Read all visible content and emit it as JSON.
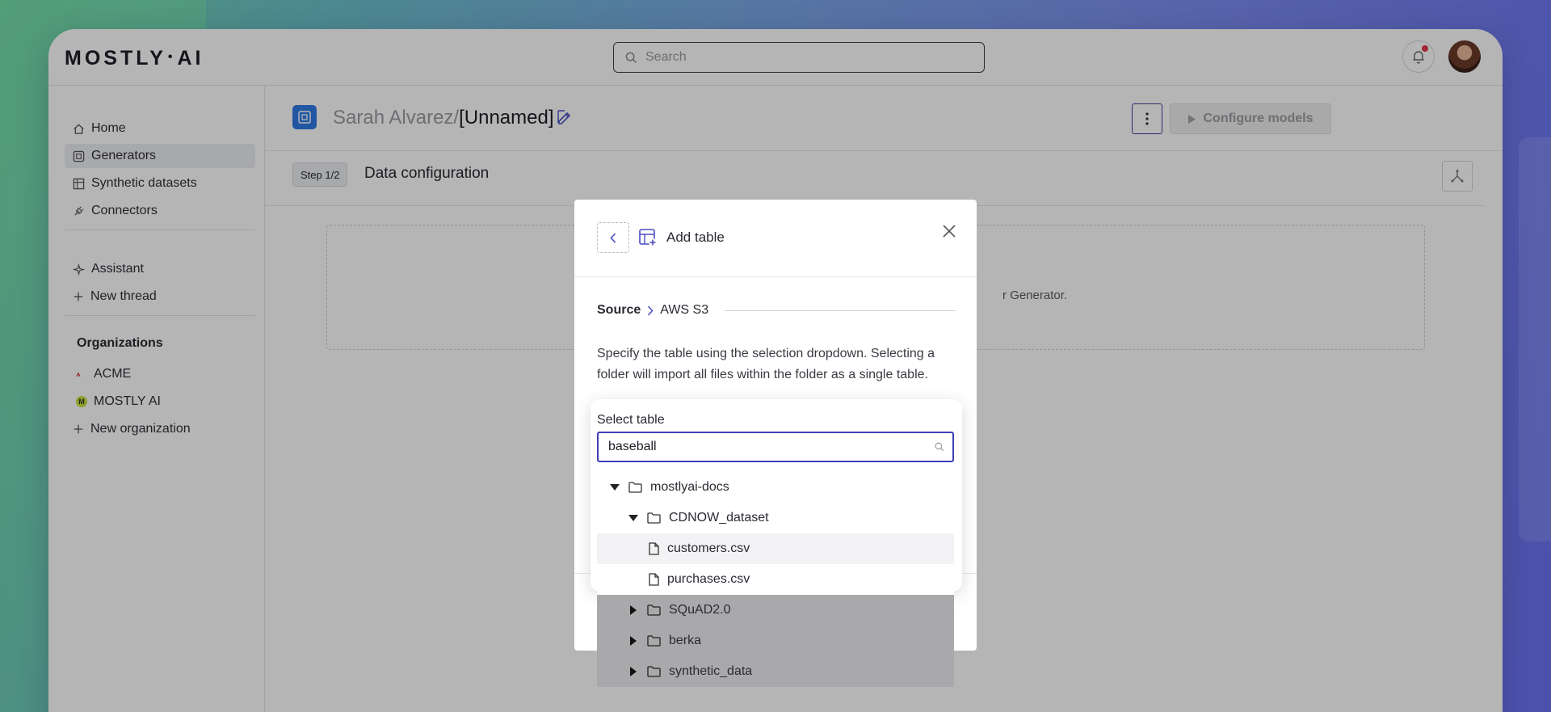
{
  "brand": {
    "logo_left": "MOSTLY",
    "logo_dot": "•",
    "logo_right": "AI"
  },
  "header": {
    "search_placeholder": "Search"
  },
  "sidebar": {
    "items": [
      {
        "label": "Home",
        "icon": "home-icon"
      },
      {
        "label": "Generators",
        "icon": "generator-icon",
        "active": true
      },
      {
        "label": "Synthetic datasets",
        "icon": "table-icon"
      },
      {
        "label": "Connectors",
        "icon": "plug-icon"
      },
      {
        "label": "Assistant",
        "icon": "sparkle-icon"
      },
      {
        "label": "New thread",
        "icon": "plus-icon"
      }
    ],
    "organizations_title": "Organizations",
    "organizations": [
      {
        "label": "ACME",
        "badge": "A",
        "color": "#d7373f"
      },
      {
        "label": "MOSTLY AI",
        "badge": "M",
        "color": "#c9e23a"
      },
      {
        "label": "New organization",
        "icon": "plus-icon"
      }
    ]
  },
  "generator": {
    "owner": "Sarah Alvarez/",
    "name": "[Unnamed]",
    "configure_label": "Configure models",
    "step_badge": "Step 1/2",
    "step_title": "Data configuration",
    "hint_fragment": "r Generator."
  },
  "modal": {
    "title": "Add table",
    "breadcrumb_source": "Source",
    "breadcrumb_target": "AWS S3",
    "description": "Specify the table using the selection dropdown. Selecting a folder will import all files within the folder as a single table.",
    "select_label": "Select table",
    "search_value": "baseball"
  },
  "tree": [
    {
      "label": "mostlyai-docs",
      "type": "folder",
      "expanded": true,
      "depth": 0
    },
    {
      "label": "CDNOW_dataset",
      "type": "folder",
      "expanded": true,
      "depth": 1
    },
    {
      "label": "customers.csv",
      "type": "file",
      "depth": 2,
      "highlighted": true
    },
    {
      "label": "purchases.csv",
      "type": "file",
      "depth": 2
    },
    {
      "label": "SQuAD2.0",
      "type": "folder",
      "expanded": false,
      "depth": 1,
      "dimmed": true
    },
    {
      "label": "berka",
      "type": "folder",
      "expanded": false,
      "depth": 1,
      "dimmed": true
    },
    {
      "label": "synthetic_data",
      "type": "folder",
      "expanded": false,
      "depth": 1,
      "dimmed": true
    }
  ],
  "colors": {
    "accent": "#3d3fb4",
    "brand_blue": "#2f7ae6",
    "notification": "#e0334a"
  }
}
